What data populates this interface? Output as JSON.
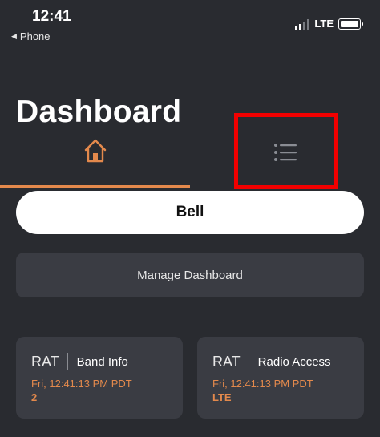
{
  "status_bar": {
    "time": "12:41",
    "back_label": "Phone",
    "network": "LTE"
  },
  "page": {
    "title": "Dashboard"
  },
  "tabs": [
    {
      "name": "home",
      "icon": "home-icon",
      "active": true
    },
    {
      "name": "list",
      "icon": "list-icon",
      "active": false
    }
  ],
  "bell_button": "Bell",
  "manage_button": "Manage Dashboard",
  "cards": [
    {
      "rat": "RAT",
      "title": "Band Info",
      "timestamp": "Fri, 12:41:13 PM PDT",
      "value": "2"
    },
    {
      "rat": "RAT",
      "title": "Radio Access",
      "timestamp": "Fri, 12:41:13 PM PDT",
      "value": "LTE"
    }
  ],
  "colors": {
    "background": "#292b30",
    "accent": "#e3894c",
    "card": "#3a3c43",
    "highlight": "#f20000"
  }
}
